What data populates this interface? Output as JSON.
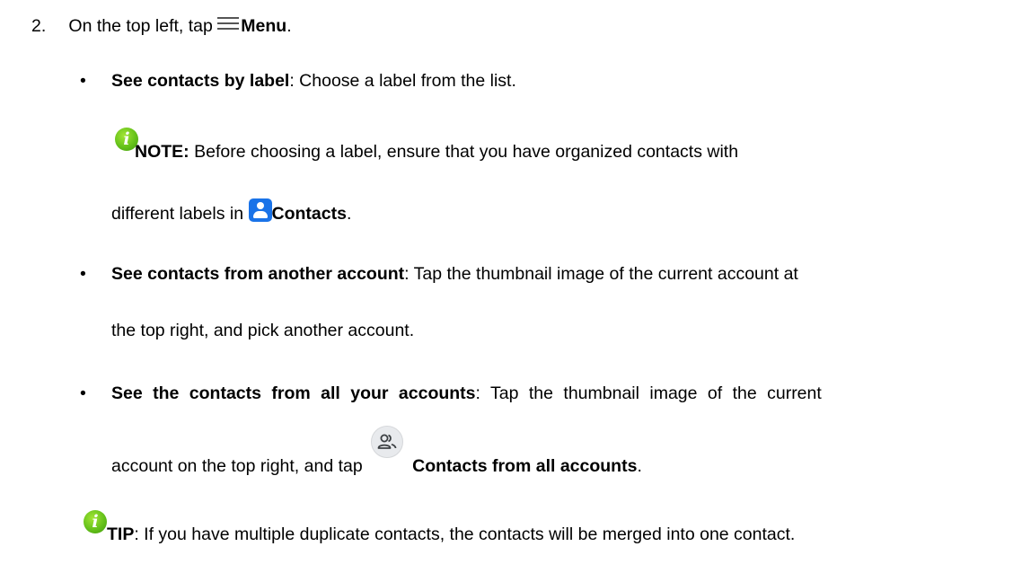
{
  "step": {
    "number": "2.",
    "text_before": "On the top left, tap",
    "icon": "menu-icon",
    "bold": "Menu",
    "text_after": "."
  },
  "bullets": [
    {
      "title": "See contacts by label",
      "desc": ": Choose a label from the list."
    },
    {
      "title": "See contacts from another account",
      "desc_line1": ": Tap the thumbnail image of the current account at",
      "desc_line2": "the top right, and pick another account."
    },
    {
      "title": "See the contacts from all your accounts",
      "desc_line1": ": Tap the thumbnail image of the current",
      "desc_line2": "account on the top right, and tap",
      "icon": "accounts-icon",
      "bold_end": "Contacts from all accounts",
      "end": "."
    }
  ],
  "note": {
    "icon": "info-icon",
    "label": "NOTE:",
    "line1": " Before choosing a label, ensure that you have organized contacts with",
    "line2": "different labels in",
    "app_icon": "contacts-app-icon",
    "app_name": "Contacts",
    "end": "."
  },
  "tip": {
    "icon": "info-icon",
    "label": "TIP",
    "text": ": If you have multiple duplicate contacts, the contacts will be merged into one contact."
  },
  "bullet_glyph": "•"
}
